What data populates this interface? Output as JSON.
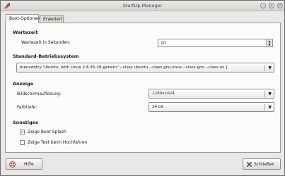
{
  "window": {
    "title": "StartUp-Manager",
    "close_glyph": "×",
    "minimize_glyph": "–",
    "maximize_glyph": "+"
  },
  "tabs": [
    {
      "label": "Boot-Optionen",
      "active": true
    },
    {
      "label": "Erweitert",
      "active": false
    }
  ],
  "timeout": {
    "heading": "Wartezeit",
    "label": "Wartezeit in Sekunden:",
    "value": "10"
  },
  "default_os": {
    "heading": "Standard-Betriebssystem",
    "value": "menuentry 'Ubuntu, with Linux 2.6.35-28-generic' --class ubuntu --class gnu-linux --class gnu --class os {"
  },
  "display": {
    "heading": "Anzeige",
    "resolution_label": "Bildschirmauflösung:",
    "resolution_value": "1280x1024",
    "depth_label": "Farbtiefe:",
    "depth_value": "24 bit"
  },
  "misc": {
    "heading": "Sonstiges",
    "splash_label": "Zeige Boot-Splash",
    "splash_checked": true,
    "text_label": "Zeige Text beim Hochfahren",
    "text_checked": false
  },
  "buttons": {
    "help": "Hilfe",
    "close": "Schließen"
  },
  "icons": {
    "app": "startup-manager-icon",
    "help": "help-lifebuoy-icon",
    "close": "close-x-icon"
  }
}
